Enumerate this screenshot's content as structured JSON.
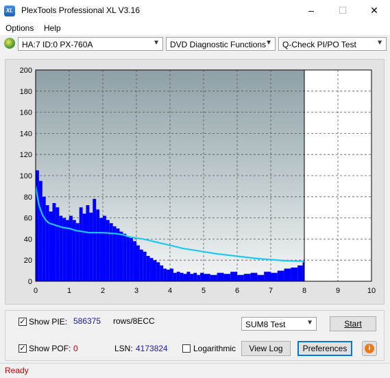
{
  "window": {
    "title": "PlexTools Professional XL V3.16",
    "app_icon": "XL"
  },
  "menu": {
    "items": [
      "Options",
      "Help"
    ]
  },
  "toolbar": {
    "drive": "HA:7 ID:0  PX-760A",
    "function": "DVD Diagnostic Functions",
    "test": "Q-Check PI/PO Test"
  },
  "chart_data": {
    "type": "bar",
    "xlim": [
      0,
      10
    ],
    "ylim": [
      0,
      200
    ],
    "x_ticks": [
      "0",
      "1",
      "2",
      "3",
      "4",
      "5",
      "6",
      "7",
      "8",
      "9",
      "10"
    ],
    "y_ticks": [
      "0",
      "20",
      "40",
      "60",
      "80",
      "100",
      "120",
      "140",
      "160",
      "180",
      "200"
    ],
    "scan_end_x": 8.0,
    "series": [
      {
        "type": "bar",
        "color": "#0000ff",
        "x": [
          0.0,
          0.1,
          0.2,
          0.3,
          0.4,
          0.5,
          0.6,
          0.7,
          0.8,
          0.9,
          1.0,
          1.1,
          1.2,
          1.3,
          1.4,
          1.5,
          1.6,
          1.7,
          1.8,
          1.9,
          2.0,
          2.1,
          2.2,
          2.3,
          2.4,
          2.5,
          2.6,
          2.7,
          2.8,
          2.9,
          3.0,
          3.1,
          3.2,
          3.3,
          3.4,
          3.5,
          3.6,
          3.7,
          3.8,
          3.9,
          4.0,
          4.1,
          4.2,
          4.3,
          4.4,
          4.5,
          4.6,
          4.7,
          4.8,
          4.9,
          5.0,
          5.2,
          5.4,
          5.6,
          5.8,
          6.0,
          6.2,
          6.4,
          6.6,
          6.8,
          7.0,
          7.2,
          7.4,
          7.6,
          7.8,
          7.95
        ],
        "values": [
          105,
          95,
          80,
          72,
          66,
          74,
          70,
          62,
          60,
          58,
          62,
          58,
          55,
          70,
          64,
          72,
          65,
          78,
          68,
          60,
          62,
          58,
          55,
          52,
          50,
          47,
          45,
          42,
          41,
          38,
          34,
          30,
          28,
          24,
          22,
          20,
          18,
          15,
          12,
          11,
          12,
          8,
          9,
          8,
          7,
          9,
          7,
          8,
          6,
          8,
          7,
          6,
          8,
          7,
          9,
          6,
          7,
          8,
          6,
          9,
          8,
          10,
          12,
          13,
          15,
          18
        ]
      },
      {
        "type": "line",
        "color": "#1ec8f0",
        "x": [
          0.0,
          0.1,
          0.2,
          0.3,
          0.4,
          0.6,
          0.8,
          1.0,
          1.2,
          1.4,
          1.6,
          1.8,
          2.0,
          2.2,
          2.4,
          2.6,
          2.8,
          3.0,
          3.2,
          3.4,
          3.6,
          3.8,
          4.0,
          4.2,
          4.4,
          4.6,
          4.8,
          5.0,
          5.4,
          5.8,
          6.2,
          6.6,
          7.0,
          7.4,
          7.8,
          8.0
        ],
        "values": [
          90,
          72,
          63,
          58,
          55,
          53,
          51,
          50,
          48,
          47,
          46,
          46,
          46,
          45.5,
          45,
          44,
          42,
          41,
          40,
          38.5,
          37,
          35.5,
          34,
          32.5,
          31,
          30,
          29,
          28,
          26,
          24.5,
          23,
          21.5,
          20.5,
          19.5,
          19,
          19
        ]
      }
    ]
  },
  "controls": {
    "show_pie": {
      "label": "Show PIE:",
      "checked": true,
      "value": "586375",
      "unit": "rows/8ECC"
    },
    "show_pof": {
      "label": "Show POF:",
      "checked": true,
      "value": "0"
    },
    "lsn": {
      "label": "LSN:",
      "value": "4173824"
    },
    "logarithmic": {
      "label": "Logarithmic",
      "checked": false
    },
    "sum_select": "SUM8 Test",
    "start_label": "Start",
    "view_log_label": "View Log",
    "preferences_label": "Preferences",
    "info_glyph": "i"
  },
  "status": {
    "text": "Ready"
  }
}
